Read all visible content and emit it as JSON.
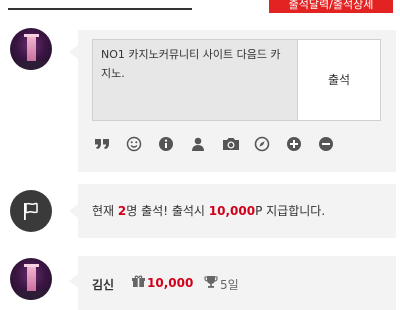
{
  "header": {
    "tab_label": "출석달력/출석상세"
  },
  "checkin": {
    "message": "NO1 카지노커뮤니티 사이트 다음드 카지노.",
    "submit_label": "출석",
    "toolbar_icons": [
      "quote-icon",
      "smile-icon",
      "info-icon",
      "user-icon",
      "camera-icon",
      "compass-icon",
      "plus-circle-icon",
      "minus-circle-icon"
    ]
  },
  "notice": {
    "prefix": "현재 ",
    "count": "2",
    "middle": "명 출석! 출석시 ",
    "points": "10,000",
    "suffix": "P 지급합니다."
  },
  "entries": [
    {
      "name": "김신",
      "points": "10,000",
      "days": "5일"
    }
  ],
  "colors": {
    "accent": "#d0021b",
    "tab_bg": "#e32222",
    "panel_bg": "#f3f3f3",
    "icon": "#555555"
  }
}
